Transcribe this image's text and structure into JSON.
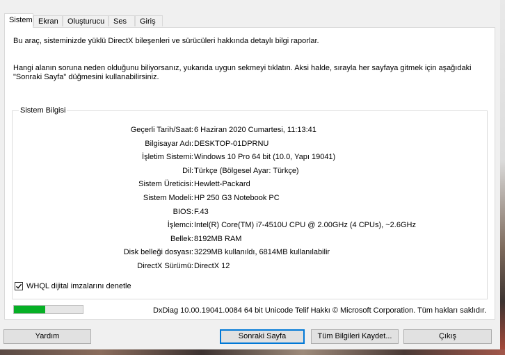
{
  "tabs": [
    {
      "label": "Sistem"
    },
    {
      "label": "Ekran"
    },
    {
      "label": "Oluşturucu"
    },
    {
      "label": "Ses"
    },
    {
      "label": "Giriş"
    }
  ],
  "intro": {
    "line1": "Bu araç, sisteminizde yüklü DirectX bileşenleri ve sürücüleri hakkında detaylı bilgi raporlar.",
    "line2": "Hangi alanın soruna neden olduğunu biliyorsanız, yukarıda uygun sekmeyi tıklatın. Aksi halde, sırayla her sayfaya gitmek için aşağıdaki \"Sonraki Sayfa\" düğmesini kullanabilirsiniz."
  },
  "system_info": {
    "title": "Sistem Bilgisi",
    "rows": [
      {
        "label": "Geçerli Tarih/Saat:",
        "value": "6 Haziran 2020 Cumartesi, 11:13:41"
      },
      {
        "label": "Bilgisayar Adı:",
        "value": "DESKTOP-01DPRNU"
      },
      {
        "label": "İşletim Sistemi:",
        "value": "Windows 10 Pro 64 bit (10.0, Yapı 19041)"
      },
      {
        "label": "Dil:",
        "value": "Türkçe (Bölgesel Ayar: Türkçe)"
      },
      {
        "label": "Sistem Üreticisi:",
        "value": "Hewlett-Packard"
      },
      {
        "label": "Sistem Modeli:",
        "value": "HP 250 G3 Notebook PC"
      },
      {
        "label": "BIOS:",
        "value": "F.43"
      },
      {
        "label": "İşlemci:",
        "value": "Intel(R) Core(TM) i7-4510U CPU @ 2.00GHz (4 CPUs), ~2.6GHz"
      },
      {
        "label": "Bellek:",
        "value": "8192MB RAM"
      },
      {
        "label": "Disk belleği dosyası:",
        "value": "3229MB kullanıldı, 6814MB kullanılabilir"
      },
      {
        "label": "DirectX Sürümü:",
        "value": "DirectX 12"
      }
    ]
  },
  "whql": {
    "label": "WHQL dijital imzalarını denetle",
    "checked": true
  },
  "progress": {
    "fraction": 0.45,
    "color": "#06b025"
  },
  "footer_text": "DxDiag 10.00.19041.0084 64 bit Unicode  Telif Hakkı © Microsoft Corporation. Tüm hakları saklıdır.",
  "buttons": {
    "help": "Yardım",
    "next": "Sonraki Sayfa",
    "save_all": "Tüm Bilgileri Kaydet...",
    "exit": "Çıkış"
  }
}
